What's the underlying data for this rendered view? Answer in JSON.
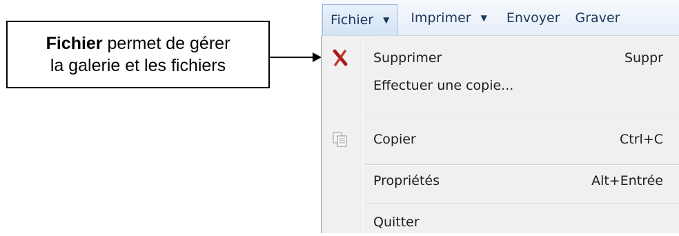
{
  "callout": {
    "bold": "Fichier",
    "line1_rest": " permet de gérer",
    "line2": "la galerie et les fichiers"
  },
  "menubar": {
    "items": [
      {
        "label": "Fichier",
        "has_dropdown": true,
        "active": true
      },
      {
        "label": "Imprimer",
        "has_dropdown": true
      },
      {
        "label": "Envoyer"
      },
      {
        "label": "Graver"
      }
    ]
  },
  "menu": {
    "items": [
      {
        "label": "Supprimer",
        "shortcut": "Suppr",
        "icon": "delete-x-icon"
      },
      {
        "label": "Effectuer une copie...",
        "shortcut": ""
      },
      {
        "label": "Copier",
        "shortcut": "Ctrl+C",
        "icon": "copy-icon"
      },
      {
        "label": "Propriétés",
        "shortcut": "Alt+Entrée"
      },
      {
        "label": "Quitter",
        "shortcut": ""
      }
    ]
  },
  "colors": {
    "menubar_text": "#1e395b",
    "delete_icon": "#b22222"
  }
}
